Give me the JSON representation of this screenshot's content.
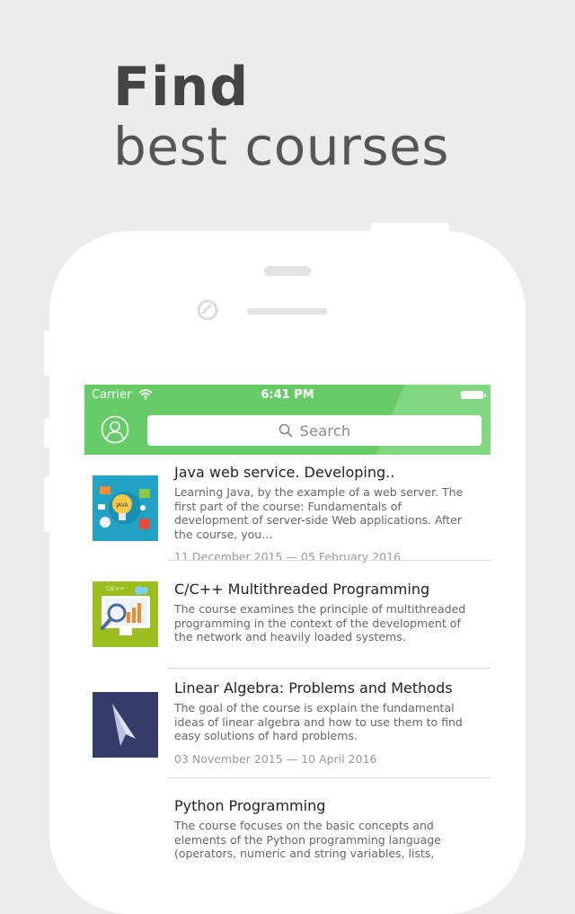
{
  "headline": {
    "line1": "Find",
    "line2": "best courses"
  },
  "status": {
    "carrier": "Carrier",
    "time": "6:41 PM"
  },
  "search": {
    "placeholder": "Search"
  },
  "colors": {
    "accent": "#67cc67",
    "accent_light": "#82d882"
  },
  "courses": [
    {
      "title": "Java web service. Developing..",
      "description": "Learning Java, by the example of a web server. The first part of the course: Fundamentals of development of server-side Web applications. After the course, you…",
      "dates": "11 December 2015 — 05 February 2016",
      "thumb": "java-course-illustration"
    },
    {
      "title": "C/C++ Multithreaded Programming",
      "description": "The course examines the principle of multithreaded programming in the context of the development of the network and heavily loaded systems.",
      "dates": "",
      "thumb": "analytics-course-illustration"
    },
    {
      "title": "Linear Algebra: Problems and Methods",
      "description": "The goal of the course is explain the fundamental ideas of linear algebra and how to use them to find easy solutions of hard problems.",
      "dates": "03 November 2015 — 10 April 2016",
      "thumb": "cursor-arrow-illustration"
    },
    {
      "title": "Python Programming",
      "description": "The course focuses on the basic concepts and elements of the Python programming language (operators, numeric and string variables, lists, conditions…",
      "dates": "",
      "thumb": "python-course-illustration"
    }
  ]
}
